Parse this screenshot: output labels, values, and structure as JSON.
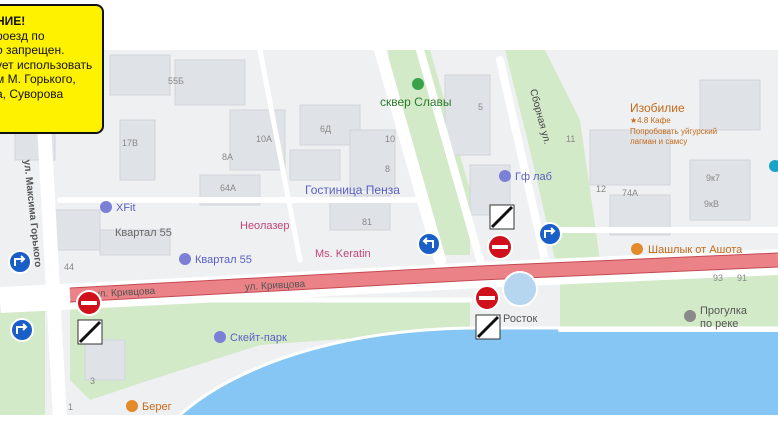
{
  "notice": {
    "lines": [
      "НИЕ!",
      "роезд по",
      "о запрещен.",
      "ует использовать",
      "м М. Горького,",
      "а, Суворова"
    ]
  },
  "streets": {
    "maksima_gorkogo": "ул. Максима Горького",
    "krivtsovo_1": "ул. Кривцова",
    "krivtsovo_2": "ул. Кривцова",
    "sbornaya": "Сборная ул."
  },
  "places": {
    "skver_slavy": "сквер Славы",
    "izobilie_name": "Изобилие",
    "izobilie_rating": "★4.8 Кафе",
    "izobilie_desc1": "Попробовать уйгурский",
    "izobilie_desc2": "лагман и самсу",
    "xfit": "XFit",
    "kvartal55_a": "Квартал 55",
    "kvartal55_b": "Квартал 55",
    "gostinitsa": "Гостиница Пенза",
    "neolazer": "Неолазер",
    "ms_keratin": "Ms. Keratin",
    "gf_lab": "Гф лаб",
    "shashlyk": "Шашлык от Ашота",
    "progulka1": "Прогулка",
    "progulka2": "по реке",
    "skeyt_park": "Скейт-парк",
    "rostok": "Росток",
    "bereg": "Берег"
  },
  "house_numbers": {
    "n55b": "55Б",
    "n17v": "17В",
    "n10a": "10А",
    "n8a": "8А",
    "n6d": "6Д",
    "n64a": "64А",
    "n10": "10",
    "n8": "8",
    "n81": "81",
    "n5": "5",
    "n11": "11",
    "n12": "12",
    "n74a": "74А",
    "n9k7": "9к7",
    "n9kv": "9кВ",
    "n44": "44",
    "n93": "93",
    "n91": "91",
    "n3": "3",
    "n1": "1"
  },
  "colors": {
    "closed_road": "#e8747a",
    "sign_red": "#d0101a",
    "sign_blue": "#1a5fc8",
    "water": "#7fc4f5",
    "park": "#cfe8c6",
    "notice_bg": "#fff200"
  }
}
